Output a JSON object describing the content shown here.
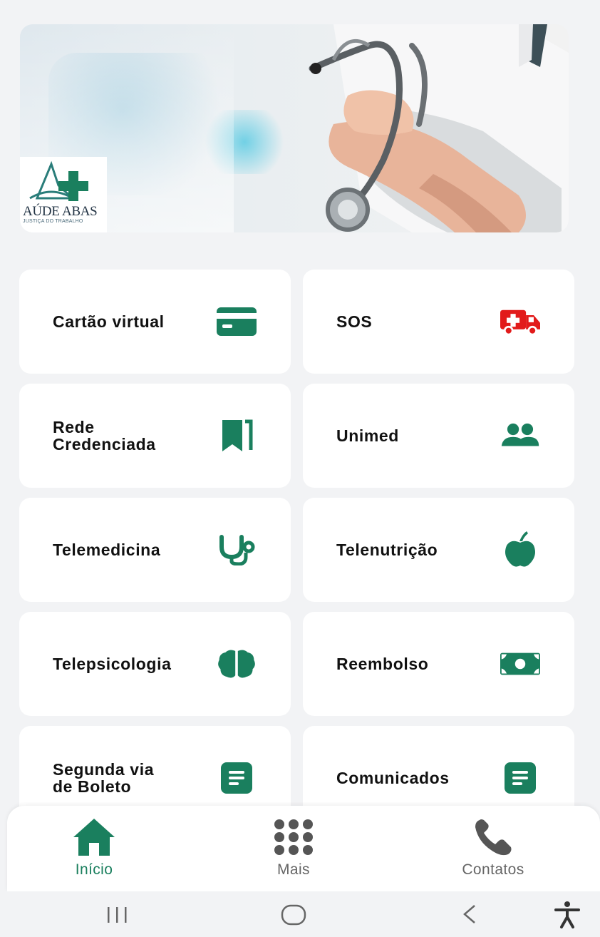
{
  "banner": {
    "logo_text": "AÚDE ABAS",
    "logo_subtext": "JUSTIÇA DO TRABALHO"
  },
  "colors": {
    "accent": "#1a7f5e",
    "sos_red": "#e21b1b",
    "active_nav": "#1a7f5e",
    "inactive_nav": "#666666"
  },
  "grid": [
    {
      "label": "Cartão virtual",
      "icon": "credit-card-icon"
    },
    {
      "label": "SOS",
      "icon": "ambulance-icon"
    },
    {
      "label": "Rede\nCredenciada",
      "icon": "bookmark-icon"
    },
    {
      "label": "Unimed",
      "icon": "users-icon"
    },
    {
      "label": "Telemedicina",
      "icon": "stethoscope-icon"
    },
    {
      "label": "Telenutrição",
      "icon": "apple-icon"
    },
    {
      "label": "Telepsicologia",
      "icon": "brain-icon"
    },
    {
      "label": "Reembolso",
      "icon": "money-bill-icon"
    },
    {
      "label": "Segunda via\nde Boleto",
      "icon": "document-icon"
    },
    {
      "label": "Comunicados",
      "icon": "document-icon"
    }
  ],
  "bottom_nav": [
    {
      "label": "Início",
      "icon": "home-icon",
      "active": true
    },
    {
      "label": "Mais",
      "icon": "grid-dots-icon",
      "active": false
    },
    {
      "label": "Contatos",
      "icon": "phone-icon",
      "active": false
    }
  ],
  "system_nav": [
    "recent-apps-icon",
    "home-circle-icon",
    "back-icon",
    "accessibility-icon"
  ]
}
